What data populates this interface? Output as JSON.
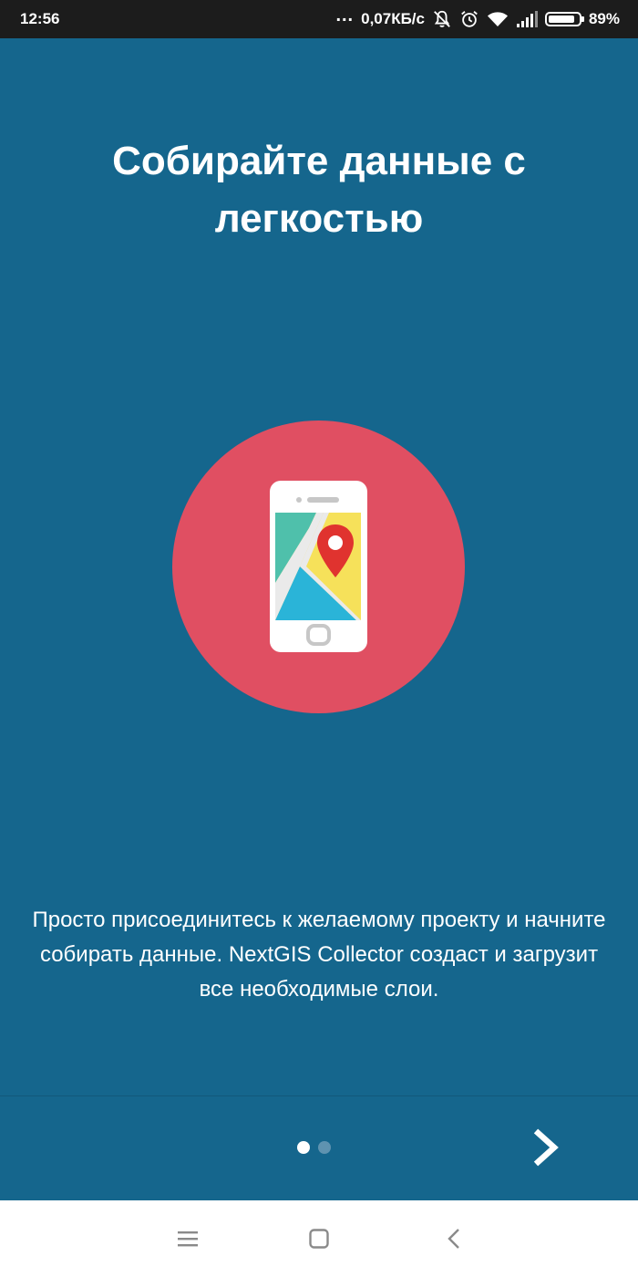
{
  "status_bar": {
    "time": "12:56",
    "dots": "...",
    "net_speed": "0,07КБ/с",
    "battery_percent": "89%",
    "battery_level": 0.89
  },
  "onboarding": {
    "title": "Собирайте данные с легкостью",
    "description": "Просто присоединитесь к желаемому проекту и начните собирать данные. NextGIS Collector создаст и загрузит все необходимые слои.",
    "page_index": 1,
    "page_count": 2,
    "illustration_icon": "phone-map-pin-icon"
  },
  "colors": {
    "background": "#15668D",
    "circle": "#E04F62",
    "status_bar": "#1C1C1C"
  },
  "nav": {
    "next_icon": "chevron-right-icon"
  },
  "system_nav": {
    "menu_icon": "menu-icon",
    "home_icon": "home-icon",
    "back_icon": "back-icon"
  }
}
